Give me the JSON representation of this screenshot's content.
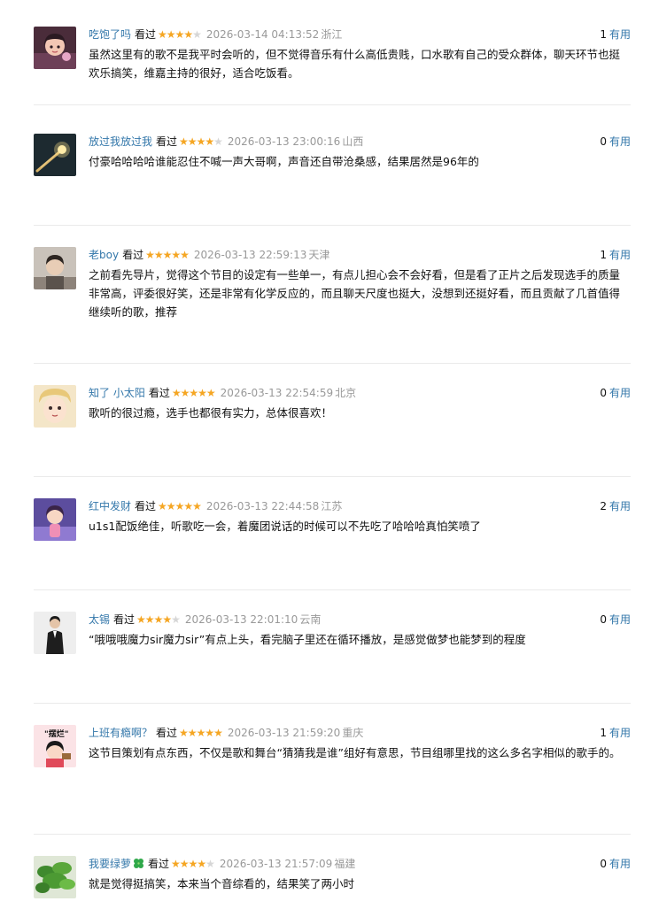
{
  "ui": {
    "watched_label": "看过",
    "useful_label": "有用"
  },
  "colors": {
    "link": "#3377aa",
    "star_on": "#f5a623",
    "star_off": "#d6d6d6",
    "meta": "#999999"
  },
  "reviews": [
    {
      "user": "吃饱了吗",
      "badge": "",
      "rating": 4,
      "time": "2026-03-14 04:13:52",
      "location": "浙江",
      "votes": "1",
      "text": "虽然这里有的歌不是我平时会听的，但不觉得音乐有什么高低贵贱，口水歌有自己的受众群体，聊天环节也挺欢乐搞笑，维嘉主持的很好，适合吃饭看。",
      "avatar": "cartoon-girl-avatar"
    },
    {
      "user": "放过我放过我",
      "badge": "",
      "rating": 4,
      "time": "2026-03-13 23:00:16",
      "location": "山西",
      "votes": "0",
      "text": "付豪哈哈哈哈谁能忍住不喊一声大哥啊，声音还自带沧桑感，结果居然是96年的",
      "avatar": "meteor-avatar"
    },
    {
      "user": "老boy",
      "badge": "",
      "rating": 5,
      "time": "2026-03-13 22:59:13",
      "location": "天津",
      "votes": "1",
      "text": "之前看先导片，觉得这个节目的设定有一些单一，有点儿担心会不会好看，但是看了正片之后发现选手的质量非常高，评委很好笑，还是非常有化学反应的，而且聊天尺度也挺大，没想到还挺好看，而且贡献了几首值得继续听的歌，推荐",
      "avatar": "photo-person-avatar"
    },
    {
      "user": "知了 小太阳",
      "badge": "",
      "rating": 5,
      "time": "2026-03-13 22:54:59",
      "location": "北京",
      "votes": "0",
      "text": "歌听的很过瘾，选手也都很有实力，总体很喜欢！",
      "avatar": "anime-face-avatar"
    },
    {
      "user": "红中发财",
      "badge": "",
      "rating": 5,
      "time": "2026-03-13 22:44:58",
      "location": "江苏",
      "votes": "2",
      "text": "u1s1配饭绝佳，听歌吃一会，着魔团说话的时候可以不先吃了哈哈哈真怕笑喷了",
      "avatar": "cartoon-girl-purple-avatar"
    },
    {
      "user": "太锡",
      "badge": "",
      "rating": 4,
      "time": "2026-03-13 22:01:10",
      "location": "云南",
      "votes": "0",
      "text": "“哦哦哦魔力sir魔力sir”有点上头，看完脑子里还在循环播放，是感觉做梦也能梦到的程度",
      "avatar": "man-in-suit-avatar"
    },
    {
      "user": "上班有瘾啊？",
      "badge": "",
      "rating": 5,
      "time": "2026-03-13 21:59:20",
      "location": "重庆",
      "votes": "1",
      "text": "这节目策划有点东西，不仅是歌和舞台“猜猜我是谁”组好有意思，节目组哪里找的这么多名字相似的歌手的。",
      "avatar": "meme-girl-avatar",
      "avatar_text": "\"摆烂\""
    },
    {
      "user": "我要绿萝",
      "badge": "clover-icon",
      "rating": 4,
      "time": "2026-03-13 21:57:09",
      "location": "福建",
      "votes": "0",
      "text": "就是觉得挺搞笑，本来当个音综看的，结果笑了两小时",
      "avatar": "plant-avatar"
    }
  ]
}
